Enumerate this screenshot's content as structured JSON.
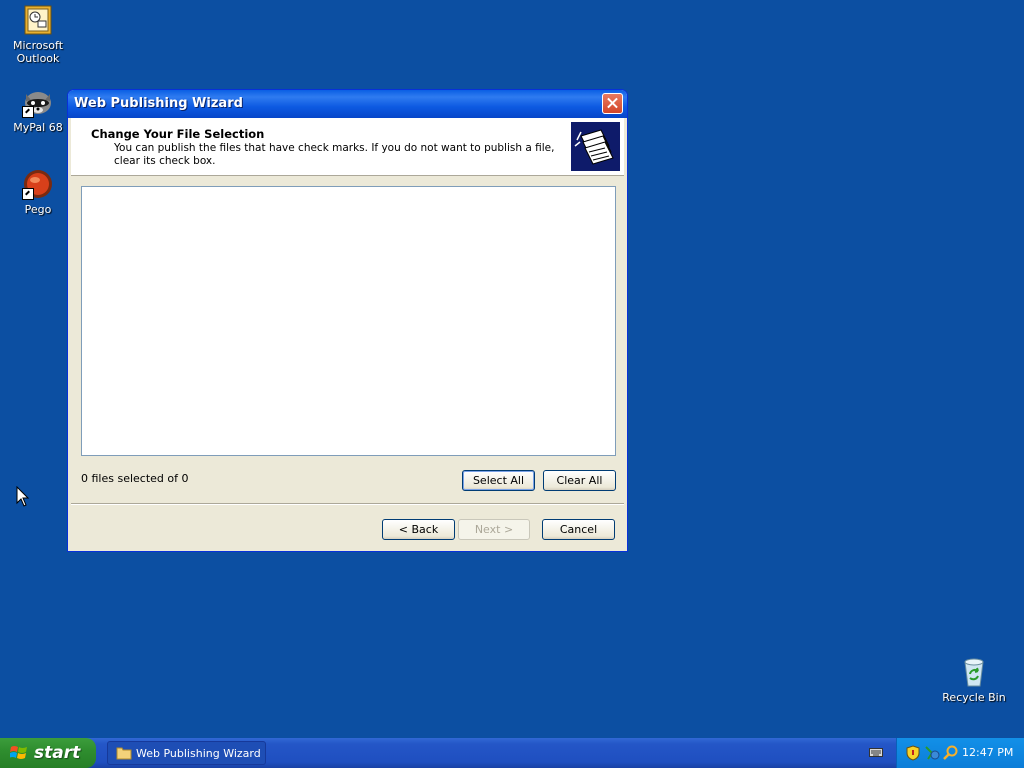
{
  "desktop": {
    "icons": [
      {
        "label": "Microsoft Outlook",
        "icon": "outlook-icon"
      },
      {
        "label": "MyPal 68",
        "icon": "raccoon-icon"
      },
      {
        "label": "Pego",
        "icon": "red-ball-icon"
      },
      {
        "label": "Recycle Bin",
        "icon": "recycle-bin-icon"
      }
    ]
  },
  "window": {
    "title": "Web Publishing Wizard",
    "header": {
      "title": "Change Your File Selection",
      "description": "You can publish the files that have check marks.  If you do not want to publish a file, clear its check box."
    },
    "status": "0 files selected of 0",
    "buttons": {
      "select_all": "Select All",
      "clear_all": "Clear All",
      "back": "< Back",
      "next": "Next >",
      "cancel": "Cancel"
    }
  },
  "taskbar": {
    "start_label": "start",
    "task_item": "Web Publishing Wizard",
    "clock": "12:47 PM"
  },
  "colors": {
    "desktop": "#0c4fa2",
    "titlebar": "#0a5fe4",
    "taskbar": "#2456c7",
    "start_button": "#2f8e2f",
    "tray": "#0c7dd8"
  }
}
